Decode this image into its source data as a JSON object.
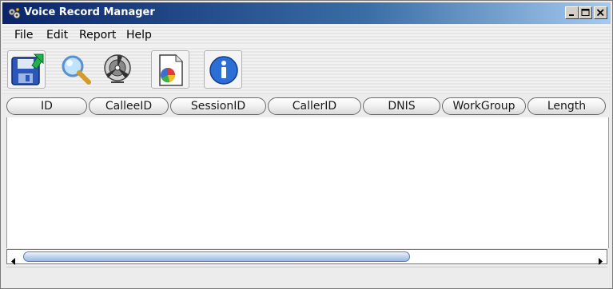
{
  "window": {
    "title": "Voice Record Manager",
    "app_icon": "gear-cluster-icon",
    "controls": [
      "minimize-icon",
      "maximize-icon",
      "close-icon"
    ]
  },
  "menu": {
    "items": [
      {
        "label": "File"
      },
      {
        "label": "Edit"
      },
      {
        "label": "Report"
      },
      {
        "label": "Help"
      }
    ]
  },
  "toolbar": {
    "buttons": [
      {
        "icon": "save-disk-icon"
      },
      {
        "icon": "magnifier-search-icon"
      },
      {
        "icon": "hazard-settings-icon"
      },
      {
        "icon": "pie-chart-report-icon"
      },
      {
        "icon": "info-icon"
      }
    ]
  },
  "table": {
    "columns": [
      "ID",
      "CalleeID",
      "SessionID",
      "CallerID",
      "DNIS",
      "WorkGroup",
      "Length"
    ],
    "rows": []
  },
  "colors": {
    "title_start": "#0a246a",
    "title_end": "#a6caf0",
    "scroll_thumb": "#9ab8de"
  }
}
